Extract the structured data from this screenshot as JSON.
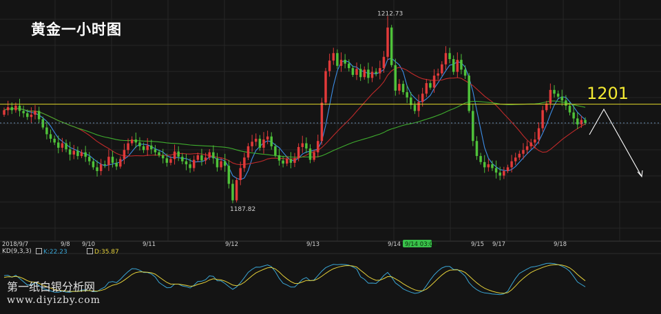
{
  "title": "黄金一小时图",
  "resistance_label": "1201",
  "colors": {
    "background": "#141414",
    "up_candle": "#e23a3a",
    "down_candle": "#4fc23a",
    "ma_fast": "#3d8ee8",
    "ma_mid": "#c02a2a",
    "ma_slow": "#3fae2e",
    "resistance_line": "#e3d82a",
    "current_price_line": "#6a8fb3",
    "k_line": "#3aa6d6",
    "d_line": "#e6d23a",
    "highlight_label_bg": "#39c24a"
  },
  "indicator": {
    "name": "KD(9,3,3)",
    "k_label": "K:22.23",
    "d_label": "D:35.87"
  },
  "watermark": {
    "line1": "第一纸白银分析网",
    "line2": "www.diyizby.com"
  },
  "chart_data": {
    "type": "candlestick",
    "title": "黄金一小时图",
    "y_range": [
      1183.5,
      1214.5
    ],
    "high_label": "1212.73",
    "low_label": "1187.82",
    "x_labels": [
      "2018/9/7",
      "9/8",
      "9/10",
      "9/11",
      "9/12",
      "9/13",
      "9/14",
      "9/14 03:00",
      "9/15",
      "9/17",
      "9/18"
    ],
    "resistance_level": 1201,
    "closes": [
      1200.2,
      1200.6,
      1200.2,
      1200.8,
      1200.1,
      1199.8,
      1199.3,
      1199.6,
      1200.1,
      1199.0,
      1197.9,
      1197.0,
      1196.4,
      1195.9,
      1195.2,
      1195.8,
      1195.0,
      1194.3,
      1194.8,
      1194.1,
      1194.6,
      1194.0,
      1193.4,
      1192.6,
      1192.1,
      1193.0,
      1192.9,
      1194.0,
      1193.2,
      1192.7,
      1193.7,
      1194.9,
      1195.8,
      1196.3,
      1195.9,
      1195.4,
      1194.9,
      1195.5,
      1195.0,
      1194.6,
      1194.2,
      1193.8,
      1193.2,
      1193.7,
      1194.7,
      1194.0,
      1193.4,
      1193.0,
      1192.5,
      1193.6,
      1194.2,
      1193.5,
      1193.9,
      1194.6,
      1193.8,
      1192.6,
      1193.4,
      1192.8,
      1190.4,
      1188.2,
      1190.9,
      1192.5,
      1193.9,
      1195.4,
      1196.0,
      1196.4,
      1195.2,
      1196.3,
      1196.7,
      1195.4,
      1194.2,
      1193.5,
      1193.1,
      1193.7,
      1193.2,
      1193.8,
      1195.3,
      1195.8,
      1195.1,
      1193.6,
      1194.6,
      1196.1,
      1201.2,
      1205.4,
      1206.8,
      1207.8,
      1206.1,
      1206.9,
      1206.4,
      1205.8,
      1204.9,
      1205.7,
      1204.6,
      1205.6,
      1204.5,
      1205.3,
      1205.1,
      1205.8,
      1207.3,
      1211.2,
      1206.2,
      1202.8,
      1203.7,
      1202.6,
      1201.9,
      1200.9,
      1200.1,
      1201.3,
      1202.4,
      1203.8,
      1203.2,
      1204.8,
      1205.1,
      1206.3,
      1207.8,
      1207.0,
      1205.3,
      1206.9,
      1205.6,
      1204.8,
      1200.1,
      1196.1,
      1194.1,
      1193.3,
      1192.6,
      1193.0,
      1192.5,
      1191.9,
      1191.5,
      1192.1,
      1192.6,
      1193.4,
      1193.9,
      1194.4,
      1194.9,
      1195.4,
      1195.9,
      1196.3,
      1197.8,
      1200.2,
      1201.1,
      1202.9,
      1202.4,
      1202.0,
      1201.5,
      1200.8,
      1199.9,
      1199.1,
      1198.3,
      1198.9,
      1198.5
    ]
  }
}
